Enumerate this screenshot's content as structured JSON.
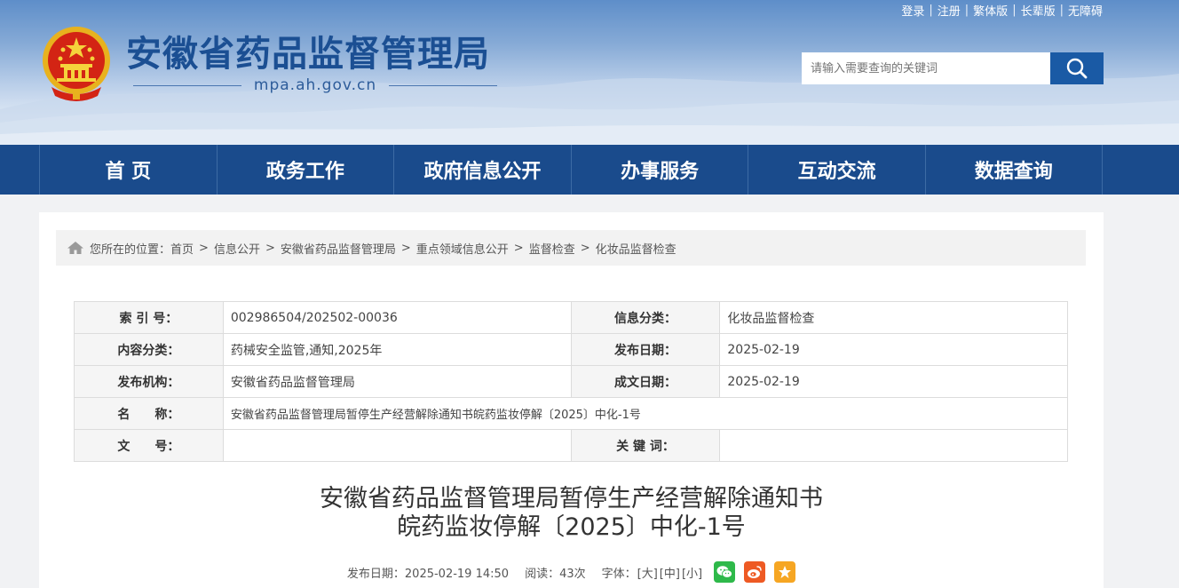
{
  "header": {
    "site_title": "安徽省药品监督管理局",
    "site_domain": "mpa.ah.gov.cn",
    "top_links": [
      "登录",
      "注册",
      "繁体版",
      "长辈版",
      "无障碍"
    ],
    "search_placeholder": "请输入需要查询的关键词"
  },
  "nav": {
    "items": [
      "首 页",
      "政务工作",
      "政府信息公开",
      "办事服务",
      "互动交流",
      "数据查询"
    ]
  },
  "breadcrumb": {
    "prefix": "您所在的位置：",
    "items": [
      "首页",
      "信息公开",
      "安徽省药品监督管理局",
      "重点领域信息公开",
      "监督检查",
      "化妆品监督检查"
    ],
    "separator": ">"
  },
  "meta": {
    "index_label": "索 引 号：",
    "index_value": "002986504/202502-00036",
    "category_label": "信息分类：",
    "category_value": "化妆品监督检查",
    "content_label": "内容分类：",
    "content_value": "药械安全监管,通知,2025年",
    "pubdate_label": "发布日期：",
    "pubdate_value": "2025-02-19",
    "org_label": "发布机构：",
    "org_value": "安徽省药品监督管理局",
    "written_label": "成文日期：",
    "written_value": "2025-02-19",
    "name_label": "名　　称：",
    "name_value": "安徽省药品监督管理局暂停生产经营解除通知书皖药监妆停解〔2025〕中化-1号",
    "docno_label": "文　　号：",
    "docno_value": "",
    "keywords_label": "关 键 词：",
    "keywords_value": ""
  },
  "article": {
    "title_line1": "安徽省药品监督管理局暂停生产经营解除通知书",
    "title_line2": "皖药监妆停解〔2025〕中化-1号",
    "publish_info": "发布日期：2025-02-19 14:50",
    "views": "阅读：43次",
    "font_label": "字体：",
    "font_large": "[大]",
    "font_medium": "[中]",
    "font_small": "[小]"
  },
  "colors": {
    "nav_bg": "#1a4b8c",
    "title_blue": "#1b4f93",
    "search_btn": "#1a5aa5",
    "wechat": "#2eb94a",
    "weibo": "#ee5a24",
    "favorite": "#f6a623"
  },
  "icons": {
    "emblem": "national-emblem-icon",
    "search": "search-icon",
    "home": "home-icon",
    "share": [
      "wechat-icon",
      "weibo-icon",
      "favorite-star-icon"
    ]
  }
}
